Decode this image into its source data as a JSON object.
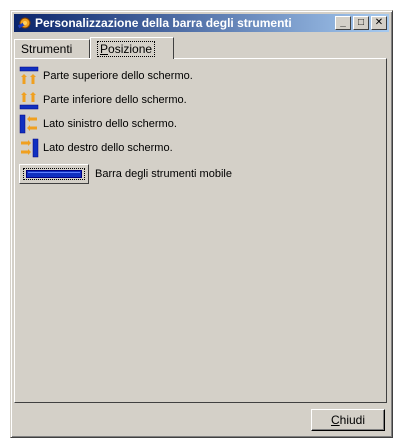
{
  "window": {
    "title": "Personalizzazione della barra degli strumenti",
    "controls": {
      "minimize": "_",
      "maximize": "□",
      "close": "✕"
    }
  },
  "tabs": [
    {
      "label": "Strumenti",
      "active": false
    },
    {
      "label_pre": "",
      "label_accel": "P",
      "label_post": "osizione",
      "active": true
    }
  ],
  "options": [
    {
      "label": "Parte superiore dello schermo.",
      "icon": "toolbar-top-icon"
    },
    {
      "label": "Parte inferiore dello schermo.",
      "icon": "toolbar-bottom-icon"
    },
    {
      "label": "Lato sinistro dello schermo.",
      "icon": "toolbar-left-icon"
    },
    {
      "label": "Lato destro dello schermo.",
      "icon": "toolbar-right-icon"
    },
    {
      "label": "Barra degli strumenti mobile",
      "icon": "floating-toolbar-icon"
    }
  ],
  "footer": {
    "close_accel": "C",
    "close_rest": "hiudi"
  },
  "colors": {
    "title_start": "#0a246a",
    "title_end": "#a6caf0",
    "face": "#d4d0c8",
    "accent_orange": "#f0a020",
    "accent_blue": "#1030c0"
  }
}
